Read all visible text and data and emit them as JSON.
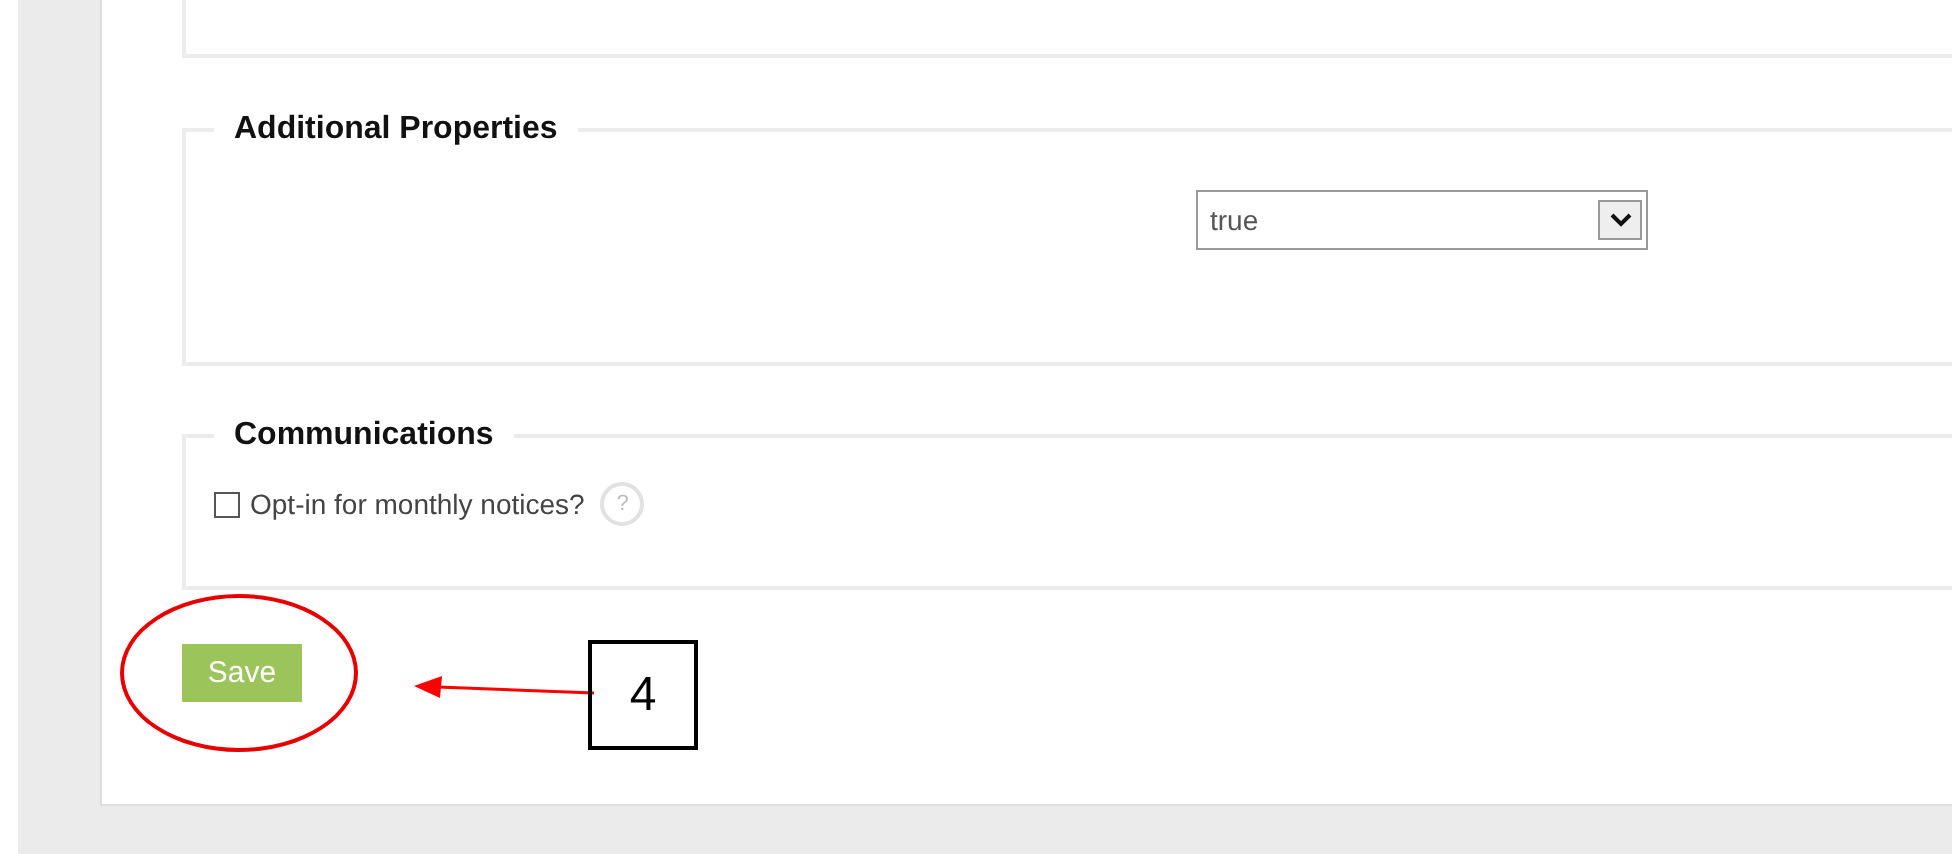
{
  "sections": [
    {
      "kind": "blank"
    },
    {
      "kind": "select",
      "legend": "Additional Properties",
      "value": "true"
    },
    {
      "kind": "checkbox",
      "legend": "Communications",
      "label": "Opt-in for monthly notices?",
      "checked": false,
      "help": "?"
    }
  ],
  "save_button": {
    "label": "Save"
  },
  "callout": {
    "label": "4"
  }
}
